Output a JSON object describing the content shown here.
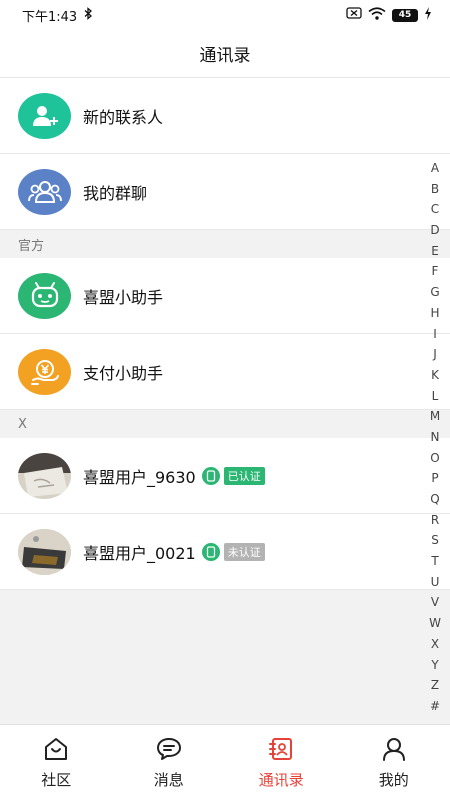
{
  "status_bar": {
    "time": "下午1:43",
    "battery": "45"
  },
  "header": {
    "title": "通讯录"
  },
  "top_items": [
    {
      "label": "新的联系人",
      "icon": "add-user-icon",
      "color": "#1ec39a"
    },
    {
      "label": "我的群聊",
      "icon": "group-icon",
      "color": "#5b82c7"
    }
  ],
  "sections": [
    {
      "title": "官方",
      "items": [
        {
          "label": "喜盟小助手",
          "icon": "robot-icon",
          "color": "#2bb673"
        },
        {
          "label": "支付小助手",
          "icon": "payment-icon",
          "color": "#f2a122"
        }
      ]
    },
    {
      "title": "X",
      "users": [
        {
          "name": "喜盟用户_9630",
          "badge": "已认证",
          "verified": true
        },
        {
          "name": "喜盟用户_0021",
          "badge": "未认证",
          "verified": false
        }
      ]
    }
  ],
  "alpha_index": [
    "A",
    "B",
    "C",
    "D",
    "E",
    "F",
    "G",
    "H",
    "I",
    "J",
    "K",
    "L",
    "M",
    "N",
    "O",
    "P",
    "Q",
    "R",
    "S",
    "T",
    "U",
    "V",
    "W",
    "X",
    "Y",
    "Z",
    "#"
  ],
  "tabs": [
    {
      "label": "社区",
      "icon": "community-icon",
      "active": false
    },
    {
      "label": "消息",
      "icon": "message-icon",
      "active": false
    },
    {
      "label": "通讯录",
      "icon": "contacts-icon",
      "active": true
    },
    {
      "label": "我的",
      "icon": "profile-icon",
      "active": false
    }
  ],
  "colors": {
    "accent": "#e5433a",
    "verified": "#2bb673",
    "unverified": "#b3b3b3"
  }
}
